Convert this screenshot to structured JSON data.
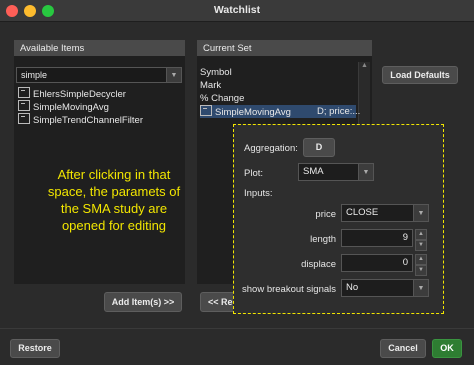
{
  "window": {
    "title": "Watchlist"
  },
  "available": {
    "header": "Available Items",
    "filter_value": "simple",
    "items": [
      {
        "label": "EhlersSimpleDecycler"
      },
      {
        "label": "SimpleMovingAvg"
      },
      {
        "label": "SimpleTrendChannelFilter"
      }
    ],
    "add_button": "Add Item(s) >>"
  },
  "current": {
    "header": "Current Set",
    "items": [
      {
        "label": "Symbol"
      },
      {
        "label": "Mark"
      },
      {
        "label": "% Change"
      }
    ],
    "selected_study": {
      "label": "SimpleMovingAvg",
      "params": "D; price:..."
    },
    "load_defaults_button": "Load Defaults",
    "remove_button": "<< Re"
  },
  "annotation": {
    "text": "After clicking in that space, the paramets of the SMA study are opened for editing"
  },
  "study_editor": {
    "aggregation_label": "Aggregation:",
    "aggregation_value": "D",
    "plot_label": "Plot:",
    "plot_value": "SMA",
    "inputs_label": "Inputs:",
    "inputs": {
      "price": {
        "label": "price",
        "value": "CLOSE"
      },
      "length": {
        "label": "length",
        "value": "9"
      },
      "displace": {
        "label": "displace",
        "value": "0"
      },
      "breakout": {
        "label": "show breakout signals",
        "value": "No"
      }
    }
  },
  "footer": {
    "restore": "Restore",
    "cancel": "Cancel",
    "ok": "OK"
  },
  "colors": {
    "annotation": "#f2e600",
    "ok_button": "#2e7d32",
    "selection": "#2f4a6e"
  },
  "icons": {
    "dropdown": "chevron-down-icon",
    "study": "study-icon",
    "spinner": "spinner-arrows-icon"
  }
}
